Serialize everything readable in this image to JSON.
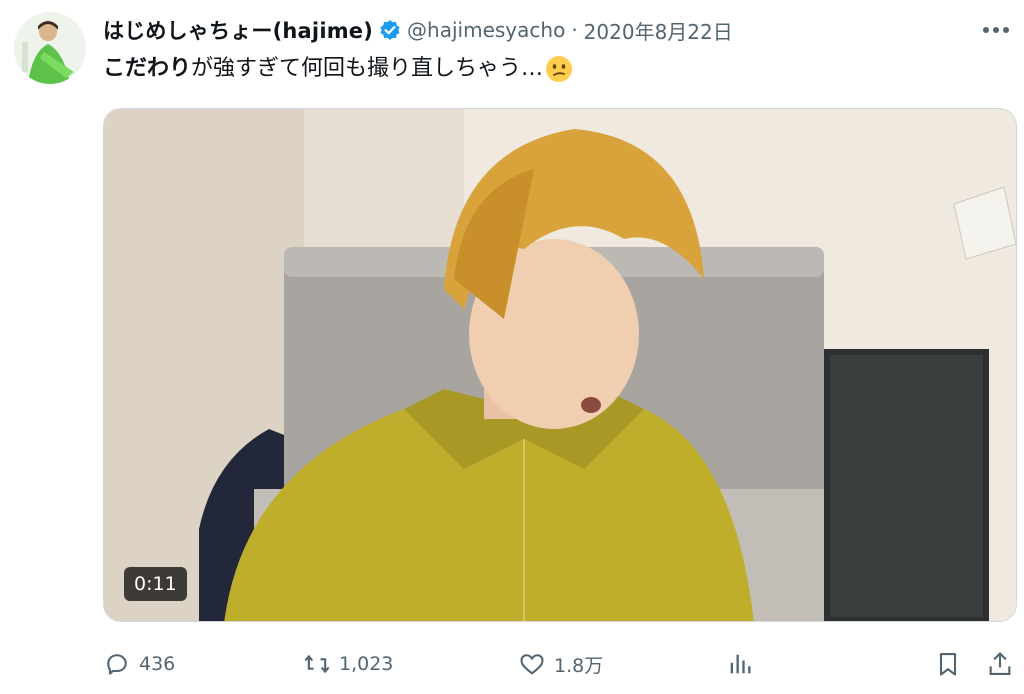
{
  "tweet": {
    "display_name": "はじめしゃちょー(hajime)",
    "handle": "@hajimesyacho",
    "separator": "·",
    "date": "2020年8月22日",
    "text_bold": "こだわり",
    "text_rest": "が強すぎて何回も撮り直しちゃう…",
    "emoji_icon": "confused-face-emoji"
  },
  "media": {
    "duration": "0:11"
  },
  "actions": {
    "replies": "436",
    "retweets": "1,023",
    "likes": "1.8万"
  },
  "colors": {
    "accent": "#1d9bf0",
    "text": "#0f1419",
    "secondary": "#536471"
  }
}
